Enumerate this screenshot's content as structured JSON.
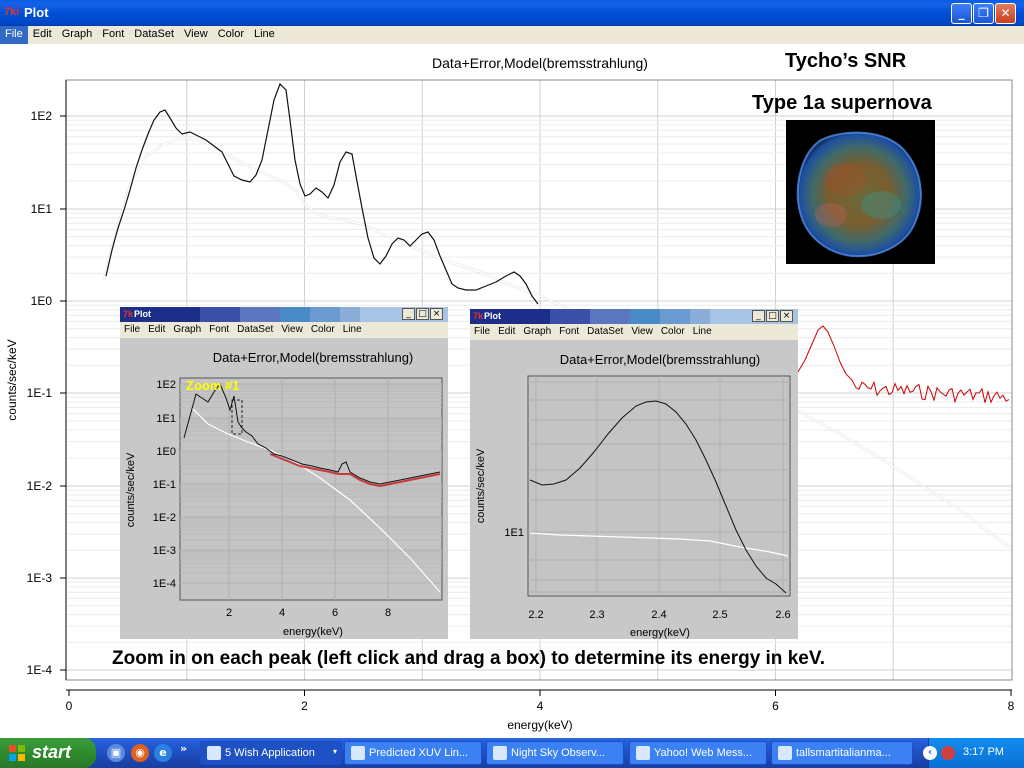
{
  "window": {
    "title": "Plot",
    "app_icon": "7ki",
    "buttons": {
      "minimize": "_",
      "restore": "❐",
      "close": "✕"
    }
  },
  "menubar": [
    "File",
    "Edit",
    "Graph",
    "Font",
    "DataSet",
    "View",
    "Color",
    "Line"
  ],
  "main_plot": {
    "title": "Data+Error,Model(bremsstrahlung)",
    "xlabel": "energy(keV)",
    "ylabel": "counts/sec/keV",
    "xticks": [
      "0",
      "2",
      "4",
      "6",
      "8"
    ],
    "yticks": [
      "1E2",
      "1E1",
      "1E0",
      "1E-1",
      "1E-2",
      "1E-3",
      "1E-4"
    ]
  },
  "annotations": {
    "snr_title": "Tycho’s SNR",
    "snr_subtitle": "Type 1a supernova",
    "caption": "Zoom in on each peak (left click and drag a box) to determine its energy in keV.",
    "zoom_label": "Zoom #1"
  },
  "subwindow_1": {
    "title": "Plot",
    "menu": [
      "File",
      "Edit",
      "Graph",
      "Font",
      "DataSet",
      "View",
      "Color",
      "Line"
    ],
    "plot_title": "Data+Error,Model(bremsstrahlung)",
    "xlabel": "energy(keV)",
    "ylabel": "counts/sec/keV",
    "xticks": [
      "2",
      "4",
      "6",
      "8"
    ],
    "yticks": [
      "1E2",
      "1E1",
      "1E0",
      "1E-1",
      "1E-2",
      "1E-3",
      "1E-4"
    ]
  },
  "subwindow_2": {
    "title": "Plot",
    "menu": [
      "File",
      "Edit",
      "Graph",
      "Font",
      "DataSet",
      "View",
      "Color",
      "Line"
    ],
    "plot_title": "Data+Error,Model(bremsstrahlung)",
    "xlabel": "energy(keV)",
    "ylabel": "counts/sec/keV",
    "xticks": [
      "2.2",
      "2.3",
      "2.4",
      "2.5",
      "2.6"
    ],
    "yticks": [
      "1E1"
    ]
  },
  "taskbar": {
    "start": "start",
    "items": [
      {
        "label": "5 Wish Application",
        "active": true
      },
      {
        "label": "Predicted XUV Lin...",
        "active": false
      },
      {
        "label": "Night Sky Observ...",
        "active": false
      },
      {
        "label": "Yahoo! Web Mess...",
        "active": false
      },
      {
        "label": "tallsmartitalianma...",
        "active": false
      }
    ],
    "overflow": "»",
    "clock": "3:17 PM"
  },
  "colors": {
    "data": "#cc0000",
    "model": "#ffffff",
    "titlebar": "#0050d8",
    "taskbar": "#245edb",
    "start": "#2e8b2e"
  }
}
